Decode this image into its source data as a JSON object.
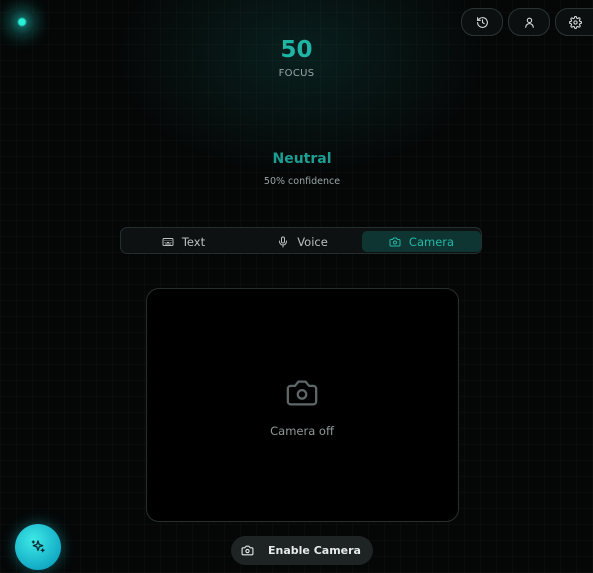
{
  "focus": {
    "score": "50",
    "label": "FOCUS"
  },
  "emotion": {
    "label": "Neutral",
    "confidence_text": "50% confidence"
  },
  "tabs": [
    {
      "label": "Text",
      "icon": "keyboard-icon",
      "active": false
    },
    {
      "label": "Voice",
      "icon": "microphone-icon",
      "active": false
    },
    {
      "label": "Camera",
      "icon": "camera-icon",
      "active": true
    }
  ],
  "camera": {
    "status_text": "Camera off",
    "enable_label": "Enable Camera"
  },
  "toolbar": {
    "icons": [
      "history-icon",
      "user-icon",
      "settings-icon"
    ]
  },
  "colors": {
    "accent": "#1fb5a5",
    "active_tab_bg": "#0f3532",
    "fab": "#22c4d8",
    "background": "#050707"
  }
}
